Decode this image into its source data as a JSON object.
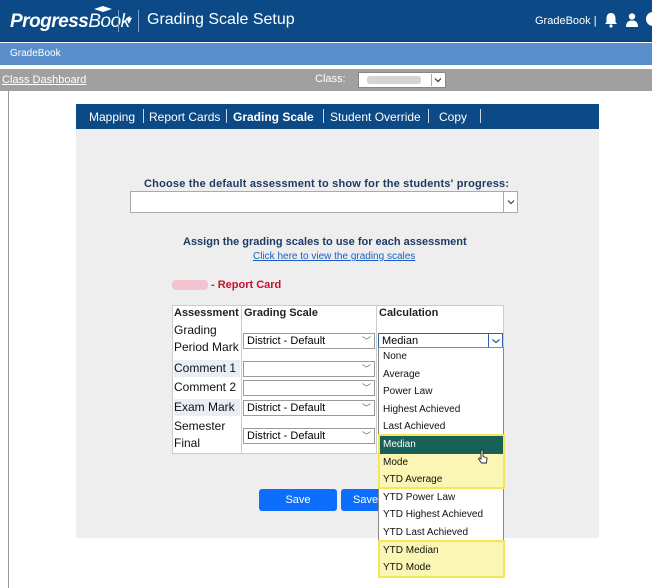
{
  "brand": {
    "name": "Progress",
    "name_suffix": "Book",
    "color_bar": "#0b4a86",
    "accent": "#5b8fcc"
  },
  "header": {
    "title": "Grading Scale Setup",
    "gradebook_link": "GradeBook |"
  },
  "subnav": {
    "label": "GradeBook"
  },
  "classbar": {
    "dashboard_link": "Class Dashboard",
    "class_label": "Class:"
  },
  "tabs": [
    "Mapping",
    "Report Cards",
    "Grading Scale",
    "Student Override",
    "Copy"
  ],
  "active_tab": "Grading Scale",
  "assessment": {
    "heading": "Choose the default assessment to show for the students' progress:",
    "value": ""
  },
  "assign": {
    "heading": "Assign the grading scales to use for each assessment",
    "link": "Click here to view the grading scales"
  },
  "report_card": {
    "title": "- Report Card"
  },
  "table": {
    "headers": [
      "Assessment",
      "Grading Scale",
      "Calculation"
    ],
    "rows": [
      {
        "assessment_l1": "Grading",
        "assessment_l2": "Period Mark",
        "scale": "District - Default",
        "calc": "Median"
      },
      {
        "assessment_l1": "Comment 1",
        "scale": ""
      },
      {
        "assessment_l1": "Comment 2",
        "scale": ""
      },
      {
        "assessment_l1": "Exam Mark",
        "scale": "District - Default"
      },
      {
        "assessment_l1": "Semester",
        "assessment_l2": "Final",
        "scale": "District - Default"
      }
    ]
  },
  "calc_options": [
    "None",
    "Average",
    "Power Law",
    "Highest Achieved",
    "Last Achieved",
    "Median",
    "Mode",
    "YTD Average",
    "YTD Power Law",
    "YTD Highest Achieved",
    "YTD Last Achieved",
    "YTD Median",
    "YTD Mode"
  ],
  "buttons": {
    "save1": "Save",
    "save2": "Save"
  }
}
